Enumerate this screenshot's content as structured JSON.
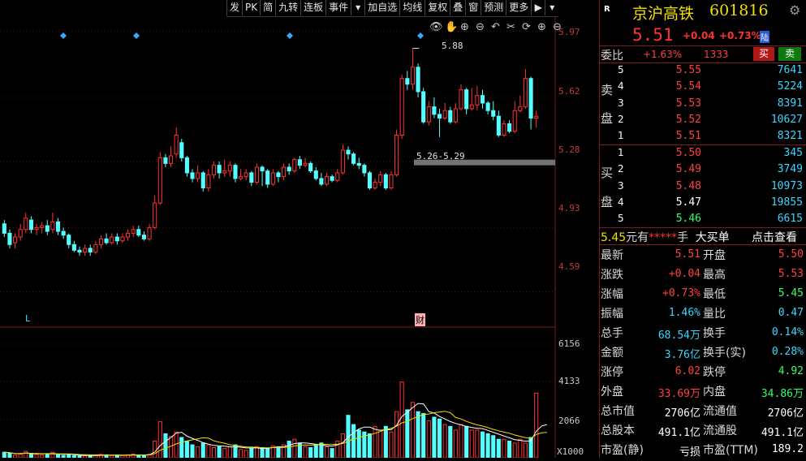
{
  "toolbar": {
    "items": [
      "发",
      "PK",
      "简",
      "九转",
      "连板",
      "事件",
      "加自选",
      "均线",
      "复权",
      "叠",
      "窗",
      "预测",
      "更多"
    ],
    "icons": [
      "eye-icon",
      "hand-icon",
      "zoom-in-icon",
      "zoom-out-icon",
      "undo-icon",
      "scissors-icon",
      "refresh-icon",
      "plus-circle-icon",
      "minus-circle-icon"
    ]
  },
  "chart": {
    "price_ticks": [
      "5.97",
      "5.62",
      "5.28",
      "4.93",
      "4.59"
    ],
    "volume_ticks": [
      "6156",
      "4133",
      "2066"
    ],
    "volume_unit": "X1000",
    "high_annotation": "5.88",
    "range_annotation": "5.26-5.29",
    "marker_L": "L",
    "marker_cai": "财",
    "colors": {
      "up": "#ff3232",
      "down": "#54ffff",
      "ma1": "#ffffff",
      "ma2": "#f0e000",
      "grid": "#5a1010"
    }
  },
  "chart_data": {
    "type": "candlestick",
    "ylim": [
      4.45,
      6.05
    ],
    "candles": [
      [
        4.95,
        4.9,
        4.97,
        4.88
      ],
      [
        4.9,
        4.84,
        4.92,
        4.82
      ],
      [
        4.85,
        4.88,
        4.9,
        4.82
      ],
      [
        4.88,
        4.92,
        4.95,
        4.86
      ],
      [
        4.92,
        4.98,
        5.01,
        4.9
      ],
      [
        4.97,
        4.92,
        4.99,
        4.9
      ],
      [
        4.92,
        4.93,
        4.95,
        4.89
      ],
      [
        4.93,
        4.94,
        4.96,
        4.9
      ],
      [
        4.94,
        4.91,
        4.97,
        4.89
      ],
      [
        4.92,
        4.96,
        5.01,
        4.9
      ],
      [
        4.96,
        4.91,
        4.98,
        4.89
      ],
      [
        4.91,
        4.89,
        4.93,
        4.87
      ],
      [
        4.89,
        4.84,
        4.9,
        4.82
      ],
      [
        4.84,
        4.81,
        4.86,
        4.8
      ],
      [
        4.81,
        4.8,
        4.83,
        4.78
      ],
      [
        4.8,
        4.82,
        4.84,
        4.78
      ],
      [
        4.82,
        4.8,
        4.84,
        4.78
      ],
      [
        4.8,
        4.84,
        4.86,
        4.79
      ],
      [
        4.84,
        4.87,
        4.89,
        4.82
      ],
      [
        4.87,
        4.85,
        4.9,
        4.84
      ],
      [
        4.85,
        4.88,
        4.9,
        4.84
      ],
      [
        4.88,
        4.86,
        4.9,
        4.84
      ],
      [
        4.86,
        4.88,
        4.9,
        4.85
      ],
      [
        4.88,
        4.9,
        4.92,
        4.86
      ],
      [
        4.9,
        4.92,
        4.94,
        4.88
      ],
      [
        4.92,
        4.89,
        4.94,
        4.88
      ],
      [
        4.89,
        4.87,
        4.91,
        4.86
      ],
      [
        4.87,
        4.93,
        4.95,
        4.86
      ],
      [
        4.93,
        5.06,
        5.1,
        4.92
      ],
      [
        5.06,
        5.3,
        5.33,
        5.05
      ],
      [
        5.3,
        5.27,
        5.32,
        5.25
      ],
      [
        5.27,
        5.31,
        5.36,
        5.25
      ],
      [
        5.32,
        5.42,
        5.46,
        5.3
      ],
      [
        5.38,
        5.3,
        5.4,
        5.28
      ],
      [
        5.3,
        5.22,
        5.31,
        5.2
      ],
      [
        5.22,
        5.19,
        5.24,
        5.17
      ],
      [
        5.19,
        5.22,
        5.26,
        5.17
      ],
      [
        5.22,
        5.14,
        5.23,
        5.12
      ],
      [
        5.14,
        5.21,
        5.24,
        5.12
      ],
      [
        5.21,
        5.26,
        5.28,
        5.19
      ],
      [
        5.26,
        5.22,
        5.28,
        5.19
      ],
      [
        5.22,
        5.23,
        5.29,
        5.2
      ],
      [
        5.23,
        5.26,
        5.28,
        5.2
      ],
      [
        5.26,
        5.19,
        5.27,
        5.17
      ],
      [
        5.19,
        5.2,
        5.24,
        5.18
      ],
      [
        5.2,
        5.22,
        5.24,
        5.18
      ],
      [
        5.22,
        5.17,
        5.23,
        5.15
      ],
      [
        5.17,
        5.25,
        5.27,
        5.16
      ],
      [
        5.25,
        5.23,
        5.26,
        5.15
      ],
      [
        5.23,
        5.16,
        5.24,
        5.14
      ],
      [
        5.16,
        5.22,
        5.24,
        5.15
      ],
      [
        5.22,
        5.2,
        5.23,
        5.17
      ],
      [
        5.2,
        5.25,
        5.27,
        5.18
      ],
      [
        5.25,
        5.23,
        5.27,
        5.21
      ],
      [
        5.23,
        5.29,
        5.3,
        5.22
      ],
      [
        5.29,
        5.26,
        5.31,
        5.24
      ],
      [
        5.26,
        5.27,
        5.3,
        5.25
      ],
      [
        5.27,
        5.23,
        5.28,
        5.22
      ],
      [
        5.23,
        5.19,
        5.25,
        5.18
      ],
      [
        5.19,
        5.16,
        5.22,
        5.15
      ],
      [
        5.16,
        5.2,
        5.22,
        5.15
      ],
      [
        5.2,
        5.18,
        5.21,
        5.17
      ],
      [
        5.18,
        5.22,
        5.24,
        5.17
      ],
      [
        5.22,
        5.34,
        5.37,
        5.21
      ],
      [
        5.34,
        5.32,
        5.36,
        5.29
      ],
      [
        5.32,
        5.27,
        5.33,
        5.26
      ],
      [
        5.27,
        5.26,
        5.3,
        5.24
      ],
      [
        5.26,
        5.22,
        5.27,
        5.2
      ],
      [
        5.22,
        5.14,
        5.23,
        5.13
      ],
      [
        5.14,
        5.17,
        5.19,
        5.13
      ],
      [
        5.17,
        5.21,
        5.23,
        5.15
      ],
      [
        5.21,
        5.14,
        5.22,
        5.13
      ],
      [
        5.14,
        5.21,
        5.23,
        5.13
      ],
      [
        5.21,
        5.42,
        5.45,
        5.2
      ],
      [
        5.42,
        5.72,
        5.74,
        5.4
      ],
      [
        5.72,
        5.69,
        5.76,
        5.66
      ],
      [
        5.69,
        5.78,
        5.88,
        5.66
      ],
      [
        5.78,
        5.65,
        5.8,
        5.62
      ],
      [
        5.65,
        5.49,
        5.67,
        5.48
      ],
      [
        5.49,
        5.57,
        5.6,
        5.47
      ],
      [
        5.57,
        5.53,
        5.62,
        5.51
      ],
      [
        5.53,
        5.51,
        5.56,
        5.41
      ],
      [
        5.51,
        5.55,
        5.59,
        5.5
      ],
      [
        5.55,
        5.49,
        5.57,
        5.48
      ],
      [
        5.49,
        5.56,
        5.59,
        5.48
      ],
      [
        5.56,
        5.66,
        5.69,
        5.55
      ],
      [
        5.66,
        5.56,
        5.67,
        5.53
      ],
      [
        5.56,
        5.58,
        5.67,
        5.55
      ],
      [
        5.58,
        5.63,
        5.68,
        5.55
      ],
      [
        5.63,
        5.59,
        5.66,
        5.56
      ],
      [
        5.59,
        5.55,
        5.6,
        5.53
      ],
      [
        5.55,
        5.52,
        5.6,
        5.5
      ],
      [
        5.52,
        5.42,
        5.55,
        5.41
      ],
      [
        5.42,
        5.48,
        5.5,
        5.41
      ],
      [
        5.48,
        5.44,
        5.5,
        5.43
      ],
      [
        5.44,
        5.55,
        5.6,
        5.43
      ],
      [
        5.55,
        5.57,
        5.63,
        5.54
      ],
      [
        5.57,
        5.72,
        5.77,
        5.56
      ],
      [
        5.72,
        5.51,
        5.73,
        5.45
      ],
      [
        5.51,
        5.52,
        5.55,
        5.46
      ]
    ],
    "volumes": [
      300,
      250,
      150,
      200,
      350,
      200,
      180,
      160,
      220,
      300,
      160,
      130,
      180,
      120,
      100,
      110,
      120,
      150,
      180,
      160,
      120,
      140,
      120,
      160,
      200,
      150,
      120,
      180,
      900,
      1950,
      1300,
      1150,
      1400,
      1100,
      900,
      700,
      600,
      800,
      700,
      550,
      600,
      500,
      600,
      700,
      450,
      400,
      500,
      600,
      550,
      500,
      650,
      600,
      700,
      900,
      1000,
      800,
      600,
      550,
      700,
      800,
      600,
      500,
      900,
      1300,
      2300,
      1800,
      1500,
      1400,
      1300,
      1700,
      1500,
      1700,
      1400,
      2500,
      4100,
      2600,
      3000,
      2500,
      2400,
      2000,
      2200,
      2100,
      1800,
      1700,
      1500,
      1800,
      1700,
      1500,
      1500,
      1400,
      1300,
      1200,
      1000,
      1000,
      900,
      800,
      1000,
      800,
      1100,
      3500,
      2200,
      1400
    ]
  },
  "panel": {
    "r_badge": "R",
    "name": "京沪高铁",
    "code": "601816",
    "price": "5.51",
    "change": "+0.04",
    "change_pct": "+0.73%",
    "lu": "陆",
    "weibi_label": "委比",
    "weibi": "+1.63%",
    "weicha": "1333",
    "buy_btn": "买",
    "sell_btn": "卖",
    "sell_label_1": "卖",
    "sell_label_2": "盘",
    "buy_label_1": "买",
    "buy_label_2": "盘",
    "asks": [
      {
        "lvl": "5",
        "price": "5.55",
        "vol": "7641"
      },
      {
        "lvl": "4",
        "price": "5.54",
        "vol": "5224"
      },
      {
        "lvl": "3",
        "price": "5.53",
        "vol": "8391"
      },
      {
        "lvl": "2",
        "price": "5.52",
        "vol": "10627"
      },
      {
        "lvl": "1",
        "price": "5.51",
        "vol": "8321"
      }
    ],
    "bids": [
      {
        "lvl": "1",
        "price": "5.50",
        "vol": "345"
      },
      {
        "lvl": "2",
        "price": "5.49",
        "vol": "3749"
      },
      {
        "lvl": "3",
        "price": "5.48",
        "vol": "10973"
      },
      {
        "lvl": "4",
        "price": "5.47",
        "vol": "19855"
      },
      {
        "lvl": "5",
        "price": "5.46",
        "vol": "6615"
      }
    ],
    "bigorder": {
      "price": "5.45",
      "text1": "元有",
      "stars": "*****",
      "text2": "手",
      "text3": "大买单",
      "link": "点击查看"
    },
    "stats": [
      {
        "l1": "最新",
        "v1": "5.51",
        "c1": "red",
        "l2": "开盘",
        "v2": "5.50",
        "c2": "red"
      },
      {
        "l1": "涨跌",
        "v1": "+0.04",
        "c1": "red",
        "l2": "最高",
        "v2": "5.53",
        "c2": "red"
      },
      {
        "l1": "涨幅",
        "v1": "+0.73%",
        "c1": "red",
        "l2": "最低",
        "v2": "5.45",
        "c2": "green"
      },
      {
        "l1": "振幅",
        "v1": "1.46%",
        "c1": "cyan",
        "l2": "量比",
        "v2": "0.47",
        "c2": "cyan"
      },
      {
        "l1": "总手",
        "v1": "68.54万",
        "c1": "cyan",
        "l2": "换手",
        "v2": "0.14%",
        "c2": "cyan"
      },
      {
        "l1": "金额",
        "v1": "3.76亿",
        "c1": "cyan",
        "l2": "换手(实)",
        "v2": "0.28%",
        "c2": "cyan"
      },
      {
        "l1": "涨停",
        "v1": "6.02",
        "c1": "red",
        "l2": "跌停",
        "v2": "4.92",
        "c2": "green"
      },
      {
        "l1": "外盘",
        "v1": "33.69万",
        "c1": "red",
        "l2": "内盘",
        "v2": "34.86万",
        "c2": "green"
      },
      {
        "l1": "总市值",
        "v1": "2706亿",
        "c1": "white",
        "l2": "流通值",
        "v2": "2706亿",
        "c2": "white"
      },
      {
        "l1": "总股本",
        "v1": "491.1亿",
        "c1": "white",
        "l2": "流通股",
        "v2": "491.1亿",
        "c2": "white"
      },
      {
        "l1": "市盈(静)",
        "v1": "亏损",
        "c1": "white",
        "l2": "市盈(TTM)",
        "v2": "189.2",
        "c2": "white"
      }
    ]
  }
}
